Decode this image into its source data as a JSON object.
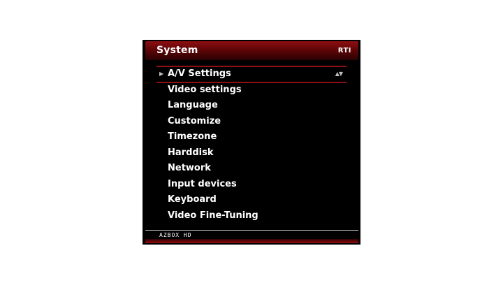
{
  "header": {
    "title": "System",
    "logo": "RTI"
  },
  "menu": {
    "selected_index": 0,
    "selected_marker_icon": "triangle-right-icon",
    "scroll_icon": "up-down-arrows-icon",
    "items": [
      {
        "label": "A/V Settings"
      },
      {
        "label": "Video settings"
      },
      {
        "label": "Language"
      },
      {
        "label": "Customize"
      },
      {
        "label": "Timezone"
      },
      {
        "label": "Harddisk"
      },
      {
        "label": "Network"
      },
      {
        "label": "Input devices"
      },
      {
        "label": "Keyboard"
      },
      {
        "label": "Video Fine-Tuning"
      }
    ]
  },
  "footer": {
    "brand": "AZBOX HD"
  },
  "colors": {
    "accent": "#8e0f12",
    "background": "#000000",
    "text": "#ffffff"
  }
}
